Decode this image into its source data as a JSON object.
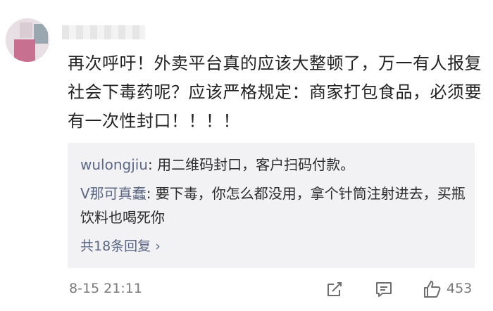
{
  "comment": {
    "username": "",
    "text": "再次呼吁！外卖平台真的应该大整顿了，万一有人报复社会下毒药呢？应该严格规定：商家打包食品，必须要有一次性封口！！！！"
  },
  "replies": [
    {
      "user": "wulongjiu",
      "text": ": 用二维码封口，客户扫码付款。"
    },
    {
      "user": "V那可真蠢",
      "text": ": 要下毒，你怎么都没用，拿个针筒注射进去，买瓶饮料也喝死你"
    }
  ],
  "more_replies": "共18条回复",
  "timestamp": "8-15 21:11",
  "like_count": "453",
  "colors": {
    "link": "#5b6784",
    "reply_bg": "#f2f2f4",
    "text": "#222222",
    "meta": "#7a7a7a"
  },
  "icons": [
    "share-icon",
    "comment-icon",
    "like-icon",
    "chevron-right-icon"
  ]
}
